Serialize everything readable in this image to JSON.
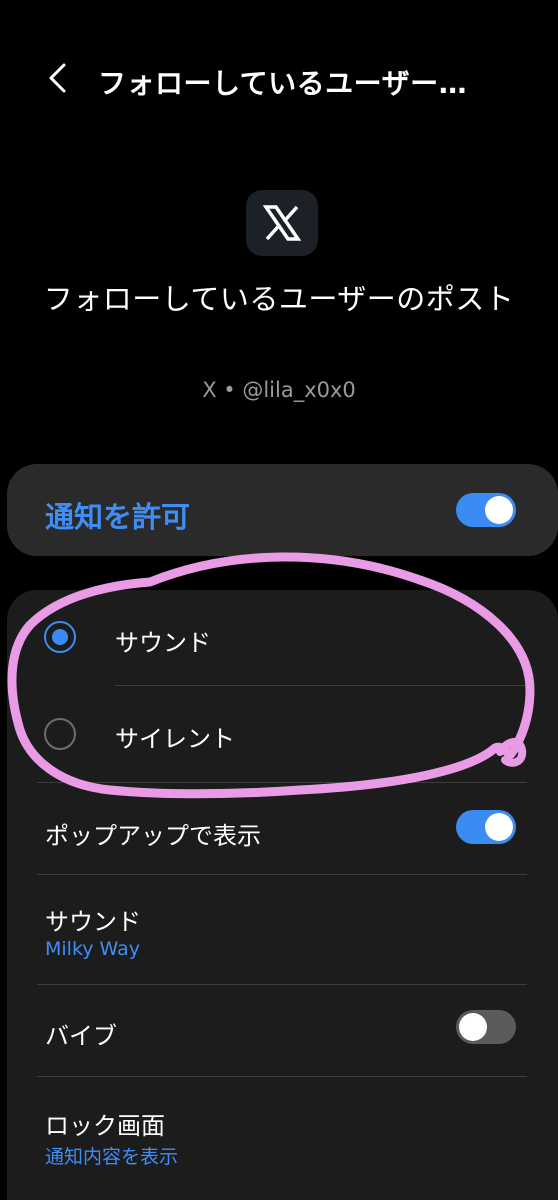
{
  "header": {
    "back_icon": "chevron-left-icon",
    "title": "フォローしているユーザー…"
  },
  "app": {
    "icon": "x-logo-icon",
    "title": "フォローしているユーザーのポスト",
    "subtitle": "X • @lila_x0x0"
  },
  "allow": {
    "label": "通知を許可",
    "enabled": true
  },
  "alert_type": {
    "options": [
      {
        "label": "サウンド",
        "selected": true
      },
      {
        "label": "サイレント",
        "selected": false
      }
    ]
  },
  "settings": {
    "popup": {
      "label": "ポップアップで表示",
      "enabled": true
    },
    "sound": {
      "label": "サウンド",
      "value": "Milky Way"
    },
    "vibrate": {
      "label": "バイブ",
      "enabled": false
    },
    "lock_screen": {
      "label": "ロック画面",
      "value": "通知内容を表示"
    }
  },
  "colors": {
    "accent": "#3a8cf2",
    "annotation": "#e99be6",
    "background": "#000000",
    "card": "#1c1c1c"
  }
}
